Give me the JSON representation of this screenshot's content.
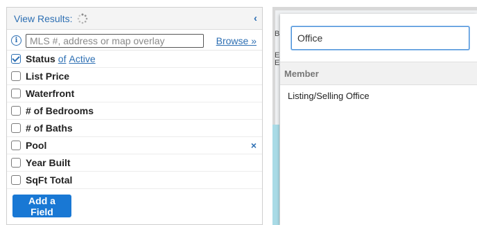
{
  "header": {
    "view_results_label": "View Results:",
    "collapse_icon": "chevron-left"
  },
  "search": {
    "placeholder": "MLS #, address or map overlay",
    "browse_label": "Browse »"
  },
  "fields": [
    {
      "label": "Status",
      "checked": true,
      "of_text": "of",
      "value": "Active"
    },
    {
      "label": "List Price",
      "checked": false
    },
    {
      "label": "Waterfront",
      "checked": false
    },
    {
      "label": "# of Bedrooms",
      "checked": false
    },
    {
      "label": "# of Baths",
      "checked": false
    },
    {
      "label": "Pool",
      "checked": false,
      "remove_icon": "×"
    },
    {
      "label": "Year Built",
      "checked": false
    },
    {
      "label": "SqFt Total",
      "checked": false
    }
  ],
  "add_field_label": "Add a Field",
  "map": {
    "label_b": "B",
    "label_el": "EL",
    "label_es": "ES"
  },
  "dropdown": {
    "input_value": "Office",
    "group_label": "Member",
    "options": [
      "Listing/Selling Office"
    ]
  },
  "colors": {
    "accent": "#2d6fb3",
    "button": "#1978d4",
    "water": "#a9dbe6"
  }
}
